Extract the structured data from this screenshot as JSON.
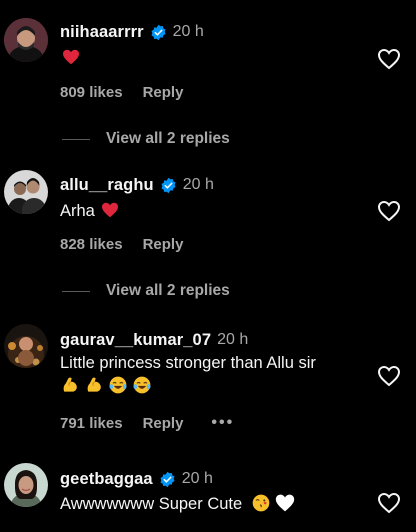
{
  "comments": [
    {
      "username": "niihaaarrrr",
      "time": "20 h",
      "likes": "809 likes",
      "reply_label": "Reply",
      "view_replies": "View all 2 replies",
      "avatar_icon": "person-hoodie-avatar"
    },
    {
      "username": "allu__raghu",
      "time": "20 h",
      "text": "Arha",
      "likes": "828 likes",
      "reply_label": "Reply",
      "view_replies": "View all 2 replies",
      "avatar_icon": "two-people-avatar"
    },
    {
      "username": "gaurav__kumar_07",
      "time": "20 h",
      "text": "Little princess stronger than Allu sir",
      "likes": "791 likes",
      "reply_label": "Reply",
      "more_label": "•••",
      "avatar_icon": "candle-child-avatar"
    },
    {
      "username": "geetbaggaa",
      "time": "20 h",
      "text": "Awwwwwww Super Cute",
      "avatar_icon": "woman-avatar"
    }
  ],
  "colors": {
    "background": "#000000",
    "text": "#f5f5f5",
    "muted": "#a8a8a8",
    "verified": "#0095f6",
    "red_heart": "#e0263c"
  }
}
